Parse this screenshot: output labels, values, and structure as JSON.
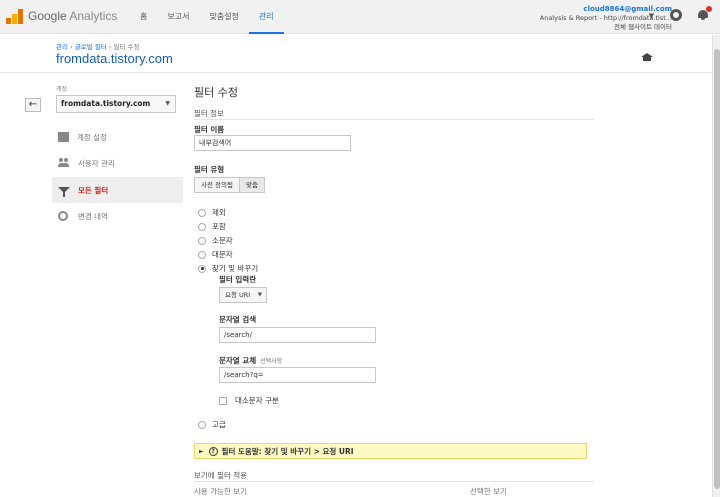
{
  "topbar": {
    "logo_google": "Google",
    "logo_analytics": "Analytics",
    "nav": [
      "홈",
      "보고서",
      "맞춤설정",
      "관리"
    ],
    "active_nav": 3,
    "account_email": "cloud8864@gmail.com",
    "account_property": "Analysis & Report - http://fromdata.tist...",
    "account_view": "전체 웹사이트 데이터"
  },
  "header": {
    "crumb_admin": "관리",
    "crumb_global": "글로벌 필터",
    "crumb_edit": "필터 수정",
    "site_title": "fromdata.tistory.com"
  },
  "sidebar": {
    "account_label": "계정",
    "account_value": "fromdata.tistory.com",
    "items": [
      {
        "label": "계정 설정",
        "icon": "building-icon"
      },
      {
        "label": "사용자 관리",
        "icon": "users-icon"
      },
      {
        "label": "모든 필터",
        "icon": "filter-icon"
      },
      {
        "label": "변경 내역",
        "icon": "history-icon"
      }
    ],
    "active_item": 2
  },
  "main": {
    "title": "필터 수정",
    "section_info": "필터 정보",
    "filter_name_label": "필터 이름",
    "filter_name_value": "내부검색어",
    "filter_type_label": "필터 유형",
    "filter_type_predefined": "사전 정의됨",
    "filter_type_custom": "맞춤",
    "radios": [
      {
        "label": "제외",
        "checked": false
      },
      {
        "label": "포함",
        "checked": false
      },
      {
        "label": "소문자",
        "checked": false
      },
      {
        "label": "대문자",
        "checked": false
      },
      {
        "label": "찾기 및 바꾸기",
        "checked": true
      }
    ],
    "filter_field_label": "필터 입력란",
    "filter_field_value": "요청 URI",
    "search_string_label": "문자열 검색",
    "search_string_value": "/search/",
    "replace_string_label": "문자열 교체",
    "replace_optional": "선택사항",
    "replace_string_value": "/search?q=",
    "case_sensitive_label": "대소문자 구분",
    "advanced_label": "고급",
    "help_text": "필터 도움말: 찾기 및 바꾸기 > 요청 URI",
    "apply_label": "보기에 필터 적용",
    "available_views": "사용 가능한 보기",
    "selected_views": "선택한 보기"
  }
}
